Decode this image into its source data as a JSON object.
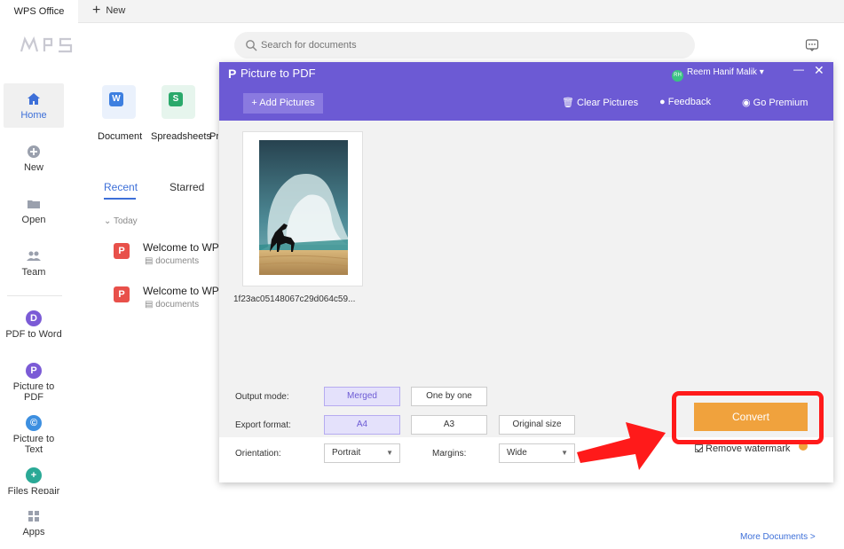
{
  "titlebar": {
    "app_tab": "WPS Office",
    "new_tab": "New"
  },
  "logo_text": "WPS",
  "sidebar": {
    "items": [
      {
        "label": "Home"
      },
      {
        "label": "New"
      },
      {
        "label": "Open"
      },
      {
        "label": "Team"
      },
      {
        "label": "PDF to Word"
      },
      {
        "label": "Picture to PDF"
      },
      {
        "label": "Picture to Text"
      },
      {
        "label": "Files Repair"
      },
      {
        "label": "Apps"
      }
    ]
  },
  "search": {
    "placeholder": "Search for documents"
  },
  "tiles": [
    {
      "label": "Document",
      "badge": "W",
      "color": "#3d7fe0"
    },
    {
      "label": "Spreadsheets",
      "badge": "S",
      "color": "#2aa96b"
    },
    {
      "label": "Pr",
      "badge": "",
      "color": "#e8763d"
    }
  ],
  "tabs": {
    "recent": "Recent",
    "starred": "Starred"
  },
  "group_today": "Today",
  "files": [
    {
      "name": "Welcome to WPS",
      "location": "documents"
    },
    {
      "name": "Welcome to WPS",
      "location": "documents"
    }
  ],
  "more_documents": "More Documents >",
  "dialog": {
    "title": "Picture to PDF",
    "user_initials": "RH",
    "user_name": "Reem Hanif Malik",
    "add_pictures": "Add Pictures",
    "clear_pictures": "Clear Pictures",
    "feedback": "Feedback",
    "go_premium": "Go Premium",
    "thumbnail_caption": "1f23ac05148067c29d064c59...",
    "output_mode_label": "Output mode:",
    "output_mode_options": [
      "Merged",
      "One by one"
    ],
    "export_format_label": "Export format:",
    "export_format_options": [
      "A4",
      "A3",
      "Original size"
    ],
    "orientation_label": "Orientation:",
    "orientation_value": "Portrait",
    "margins_label": "Margins:",
    "margins_value": "Wide",
    "convert": "Convert",
    "remove_watermark": "Remove watermark",
    "accent_color": "#6c5ad4",
    "convert_color": "#f0a23d"
  },
  "annotation_color": "#ff1a1a"
}
